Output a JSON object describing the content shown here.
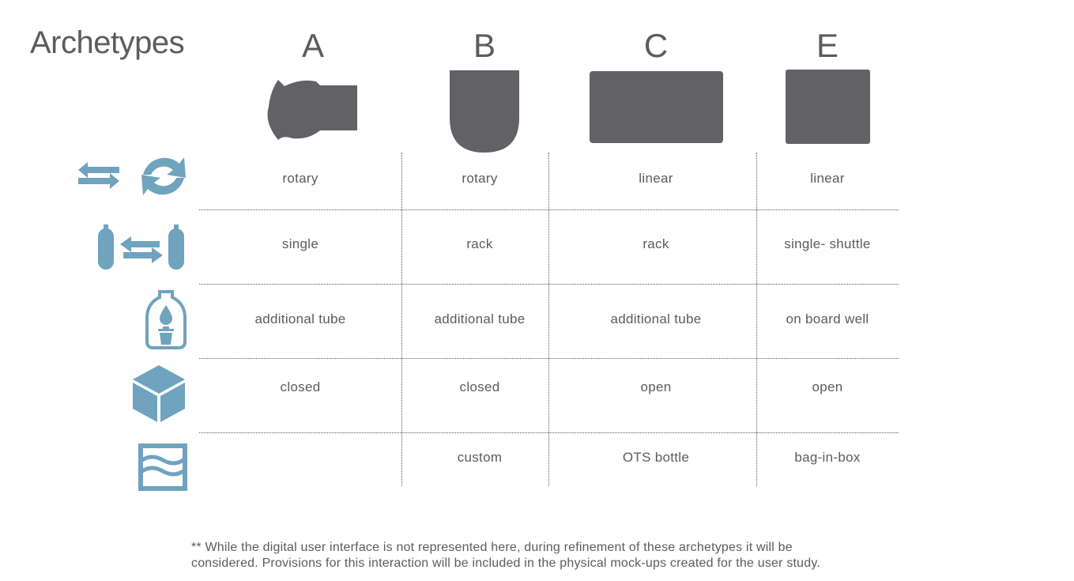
{
  "title": "Archetypes",
  "columns": [
    "A",
    "B",
    "C",
    "E"
  ],
  "rows": [
    {
      "icon": "transfer-rotate-icon",
      "cells": [
        "rotary",
        "rotary",
        "linear",
        "linear"
      ]
    },
    {
      "icon": "tube-exchange-icon",
      "cells": [
        "single",
        "rack",
        "rack",
        "single- shuttle"
      ]
    },
    {
      "icon": "bottle-drop-waste-icon",
      "cells": [
        "additional tube",
        "additional tube",
        "additional tube",
        "on board well"
      ]
    },
    {
      "icon": "cube-icon",
      "cells": [
        "closed",
        "closed",
        "open",
        "open"
      ]
    },
    {
      "icon": "liquid-container-icon",
      "cells": [
        "",
        "custom",
        "OTS bottle",
        "bag-in-box"
      ]
    }
  ],
  "footnote": {
    "line1": "** While the digital user interface is not represented here, during refinement of these archetypes it will be",
    "line2": "considered. Provisions for this interaction will be included in the physical mock-ups created for the user study."
  },
  "colors": {
    "icon": "#6fa3be",
    "silhouette": "#616166",
    "text": "#5b5b60"
  }
}
